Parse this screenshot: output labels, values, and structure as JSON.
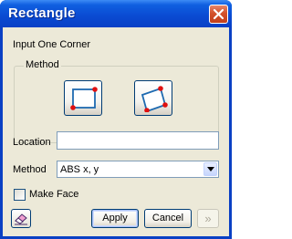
{
  "window": {
    "title": "Rectangle"
  },
  "prompt": "Input One Corner",
  "method_group": {
    "legend": "Method",
    "buttons": [
      {
        "name": "axis-aligned-rectangle"
      },
      {
        "name": "rotated-rectangle"
      }
    ]
  },
  "location": {
    "label": "Location",
    "value": ""
  },
  "method": {
    "label": "Method",
    "selected": "ABS x, y"
  },
  "make_face": {
    "label": "Make Face",
    "checked": false
  },
  "buttons": {
    "apply": "Apply",
    "cancel": "Cancel",
    "more": "»"
  },
  "colors": {
    "titlebar": "#0a4ad2",
    "client": "#ece9d8",
    "accent": "#1e6ab0",
    "marker": "#e01010"
  }
}
